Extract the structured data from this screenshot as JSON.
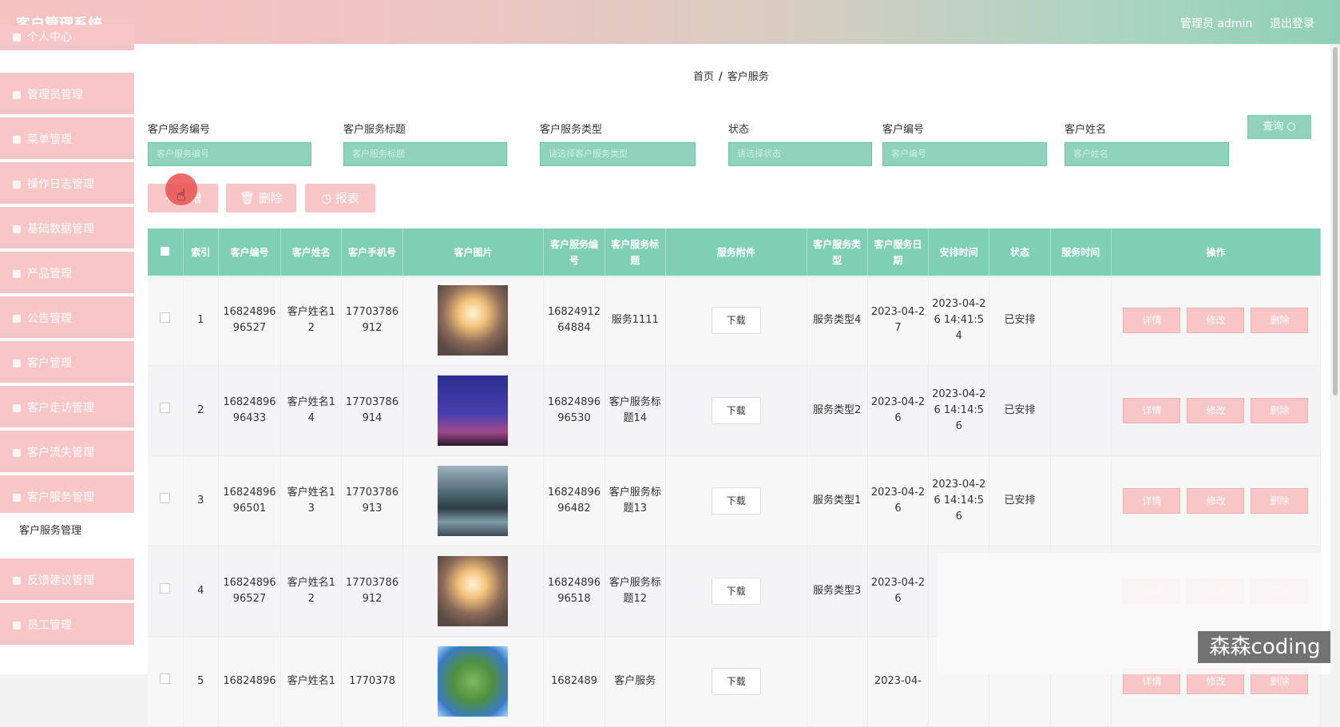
{
  "header": {
    "title": "客户管理系统",
    "admin": "管理员 admin",
    "logout": "退出登录"
  },
  "sidebar": {
    "items": [
      {
        "label": "个人中心"
      },
      {
        "label": "管理员管理"
      },
      {
        "label": "菜单管理"
      },
      {
        "label": "操作日志管理"
      },
      {
        "label": "基础数据管理"
      },
      {
        "label": "产品管理"
      },
      {
        "label": "公告管理"
      },
      {
        "label": "客户管理"
      },
      {
        "label": "客户走访管理"
      },
      {
        "label": "客户流失管理"
      },
      {
        "label": "客户服务管理"
      },
      {
        "label": "反馈建议管理"
      },
      {
        "label": "员工管理"
      }
    ],
    "sub_item": "客户服务管理"
  },
  "breadcrumb": {
    "home": "首页",
    "sep": "/",
    "current": "客户服务"
  },
  "filters": [
    {
      "label": "客户服务编号",
      "placeholder": "客户服务编号"
    },
    {
      "label": "客户服务标题",
      "placeholder": "客户服务标题"
    },
    {
      "label": "客户服务类型",
      "placeholder": "请选择客户服务类型"
    },
    {
      "label": "状态",
      "placeholder": "请选择状态"
    },
    {
      "label": "客户编号",
      "placeholder": "客户编号"
    },
    {
      "label": "客户姓名",
      "placeholder": "客户姓名"
    }
  ],
  "query_button": "查询",
  "actions": {
    "add": "新增",
    "delete": "删除",
    "report": "报表"
  },
  "table": {
    "headers": [
      "索引",
      "客户编号",
      "客户姓名",
      "客户手机号",
      "客户图片",
      "客户服务编号",
      "客户服务标题",
      "服务附件",
      "客户服务类型",
      "客户服务日期",
      "安排时间",
      "状态",
      "服务时间",
      "操作"
    ],
    "rows": [
      {
        "idx": "1",
        "cust_no": "1682489696527",
        "name": "客户姓名12",
        "phone": "17703786912",
        "image": "sunset-globe",
        "svc_no": "1682491264884",
        "svc_title": "服务1111",
        "download": "下载",
        "type": "服务类型4",
        "date": "2023-04-27",
        "arranged": "2023-04-26 14:41:54",
        "status": "已安排",
        "svc_time": ""
      },
      {
        "idx": "2",
        "cust_no": "1682489696433",
        "name": "客户姓名14",
        "phone": "17703786914",
        "image": "eiffel-tower",
        "svc_no": "1682489696530",
        "svc_title": "客户服务标题14",
        "download": "下载",
        "type": "服务类型2",
        "date": "2023-04-26",
        "arranged": "2023-04-26 14:14:56",
        "status": "已安排",
        "svc_time": ""
      },
      {
        "idx": "3",
        "cust_no": "1682489696501",
        "name": "客户姓名13",
        "phone": "17703786913",
        "image": "lake-town",
        "svc_no": "1682489696482",
        "svc_title": "客户服务标题13",
        "download": "下载",
        "type": "服务类型1",
        "date": "2023-04-26",
        "arranged": "2023-04-26 14:14:56",
        "status": "已安排",
        "svc_time": ""
      },
      {
        "idx": "4",
        "cust_no": "1682489696527",
        "name": "客户姓名12",
        "phone": "17703786912",
        "image": "sunset-globe",
        "svc_no": "1682489696518",
        "svc_title": "客户服务标题12",
        "download": "下载",
        "type": "服务类型3",
        "date": "2023-04-26",
        "arranged": "",
        "status": "",
        "svc_time": ""
      },
      {
        "idx": "5",
        "cust_no": "16824896",
        "name": "客户姓名1",
        "phone": "1770378",
        "image": "planet-globe",
        "svc_no": "1682489",
        "svc_title": "客户服务",
        "download": "下载",
        "type": "",
        "date": "2023-04-",
        "arranged": "",
        "status": "",
        "svc_time": ""
      }
    ],
    "ops": {
      "detail": "详情",
      "edit": "修改",
      "delete": "删除"
    }
  },
  "watermark": "森森coding"
}
